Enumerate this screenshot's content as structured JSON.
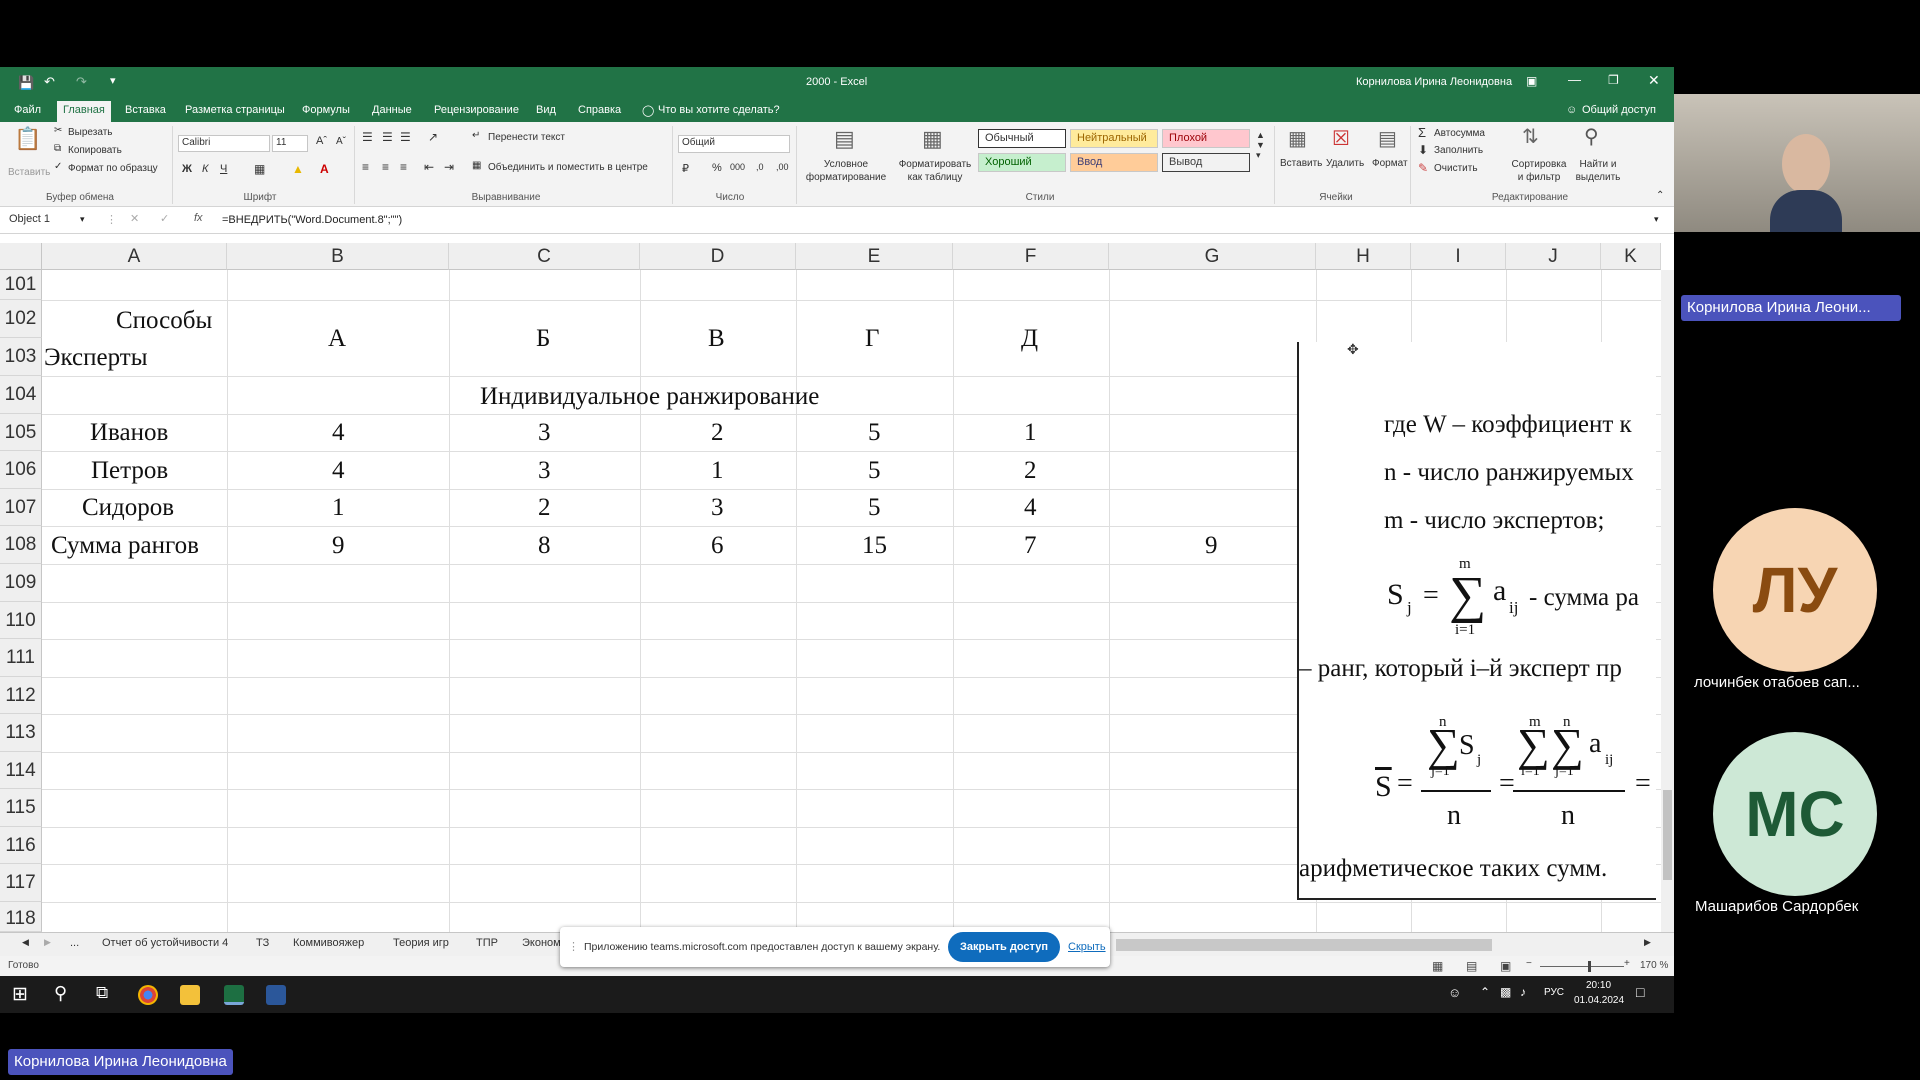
{
  "excel": {
    "title": "2000  -  Excel",
    "user": "Корнилова Ирина Леонидовна",
    "tabs": [
      "Файл",
      "Главная",
      "Вставка",
      "Разметка страницы",
      "Формулы",
      "Данные",
      "Рецензирование",
      "Вид",
      "Справка"
    ],
    "tell_me": "Что вы хотите сделать?",
    "share": "Общий доступ",
    "ribbon": {
      "paste": "Вставить",
      "cut": "Вырезать",
      "copy": "Копировать",
      "format_painter": "Формат по образцу",
      "clipboard": "Буфер обмена",
      "font_name": "Calibri",
      "font_size": "11",
      "font": "Шрифт",
      "bold": "Ж",
      "italic": "К",
      "underline": "Ч",
      "wrap_text": "Перенести текст",
      "merge_center": "Объединить и поместить в центре",
      "alignment": "Выравнивание",
      "number_format": "Общий",
      "number": "Число",
      "cond_format": "Условное форматирование",
      "format_table": "Форматировать как таблицу",
      "styles": "Стили",
      "style_normal": "Обычный",
      "style_neutral": "Нейтральный",
      "style_bad": "Плохой",
      "style_good": "Хороший",
      "style_input": "Ввод",
      "style_output": "Вывод",
      "insert": "Вставить",
      "delete": "Удалить",
      "format": "Формат",
      "cells": "Ячейки",
      "autosum": "Автосумма",
      "fill": "Заполнить",
      "clear": "Очистить",
      "sort_filter": "Сортировка и фильтр",
      "find_select": "Найти и выделить",
      "editing": "Редактирование"
    },
    "name_box": "Object 1",
    "formula": "=ВНЕДРИТЬ(\"Word.Document.8\";\"\")",
    "columns": [
      "A",
      "B",
      "C",
      "D",
      "E",
      "F",
      "G",
      "H",
      "I",
      "J",
      "K"
    ],
    "rows": [
      "101",
      "102",
      "103",
      "104",
      "105",
      "106",
      "107",
      "108",
      "109",
      "110",
      "111",
      "112",
      "113",
      "114",
      "115",
      "116",
      "117",
      "118"
    ],
    "cells": {
      "hdr_sposoby": "Способы",
      "hdr_eksperty": "Эксперты",
      "opts": [
        "А",
        "Б",
        "В",
        "Г",
        "Д"
      ],
      "individual": "Индивидуальное ранжирование",
      "data": [
        {
          "name": "Иванов",
          "vals": [
            "4",
            "3",
            "2",
            "5",
            "1"
          ]
        },
        {
          "name": "Петров",
          "vals": [
            "4",
            "3",
            "1",
            "5",
            "2"
          ]
        },
        {
          "name": "Сидоров",
          "vals": [
            "1",
            "2",
            "3",
            "5",
            "4"
          ]
        },
        {
          "name": "Сумма рангов",
          "vals": [
            "9",
            "8",
            "6",
            "15",
            "7"
          ]
        }
      ],
      "g108": "9"
    },
    "overlay": {
      "line1": "где W – коэффициент к",
      "line2": "n - число ранжируемых",
      "line3": "m - число экспертов;",
      "sj": "S",
      "sj_sub": "j",
      "eq": "=",
      "sum_top": "m",
      "sum_bot": "i=1",
      "a": "a",
      "a_sub": "ij",
      "sum_rank": "- сумма ра",
      "line_rank": "– ранг, который i–й эксперт пр",
      "sbar": "S",
      "n": "n",
      "sj2": "S",
      "sj2_sub": "j",
      "j1": "j=1",
      "i1": "i=1",
      "m": "m",
      "nn": "n",
      "aij": "a",
      "aij_sub": "ij",
      "line_last": "арифметическое таких сумм."
    },
    "sheets": [
      "...",
      "Отчет об устойчивости 4",
      "ТЗ",
      "Коммивояжер",
      "Теория игр",
      "ТПР",
      "Эконом"
    ],
    "status": "Готово",
    "zoom": "170 %"
  },
  "share_bar": {
    "text": "Приложению teams.microsoft.com предоставлен доступ к вашему экрану.",
    "stop": "Закрыть доступ",
    "hide": "Скрыть"
  },
  "taskbar": {
    "lang": "РУС",
    "time": "20:10",
    "date": "01.04.2024"
  },
  "participants": [
    {
      "initials": "",
      "name": "Корнилова Ирина Леони..."
    },
    {
      "initials": "ЛУ",
      "name": "лочинбек отабоев сап..."
    },
    {
      "initials": "МС",
      "name": "Машарибов Сардорбек"
    }
  ],
  "presenter": "Корнилова Ирина Леонидовна",
  "colors": {
    "excel_green": "#217346",
    "teams_blue": "#4b53bc",
    "lu_bg": "#f7d5b3",
    "lu_fg": "#8a4b10",
    "ms_bg": "#cde8d6",
    "ms_fg": "#1e5a36"
  }
}
